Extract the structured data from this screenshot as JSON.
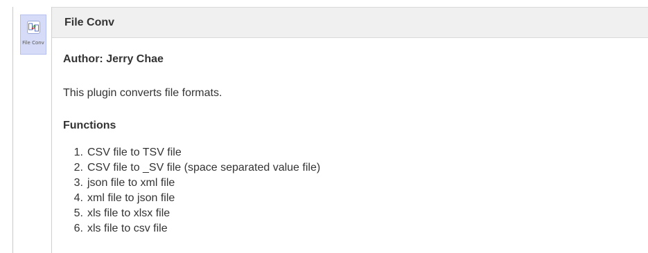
{
  "sidebar": {
    "plugin_label": "File Conv",
    "plugin_icon": "file-convert-icon"
  },
  "header": {
    "title": "File Conv"
  },
  "content": {
    "author": "Author: Jerry Chae",
    "description": "This plugin converts file formats.",
    "functions_heading": "Functions",
    "functions": [
      {
        "num": "1.",
        "text": "CSV file to TSV file"
      },
      {
        "num": "2.",
        "text": "CSV file to _SV file (space separated value file)"
      },
      {
        "num": "3.",
        "text": "json file to xml file"
      },
      {
        "num": "4.",
        "text": "xml file to json file"
      },
      {
        "num": "5.",
        "text": "xls file to xlsx file"
      },
      {
        "num": "6.",
        "text": "xls file to csv file"
      }
    ]
  },
  "colors": {
    "tile_background": "#d6dcf8",
    "header_background": "#f0f0f0",
    "text": "#333333"
  }
}
